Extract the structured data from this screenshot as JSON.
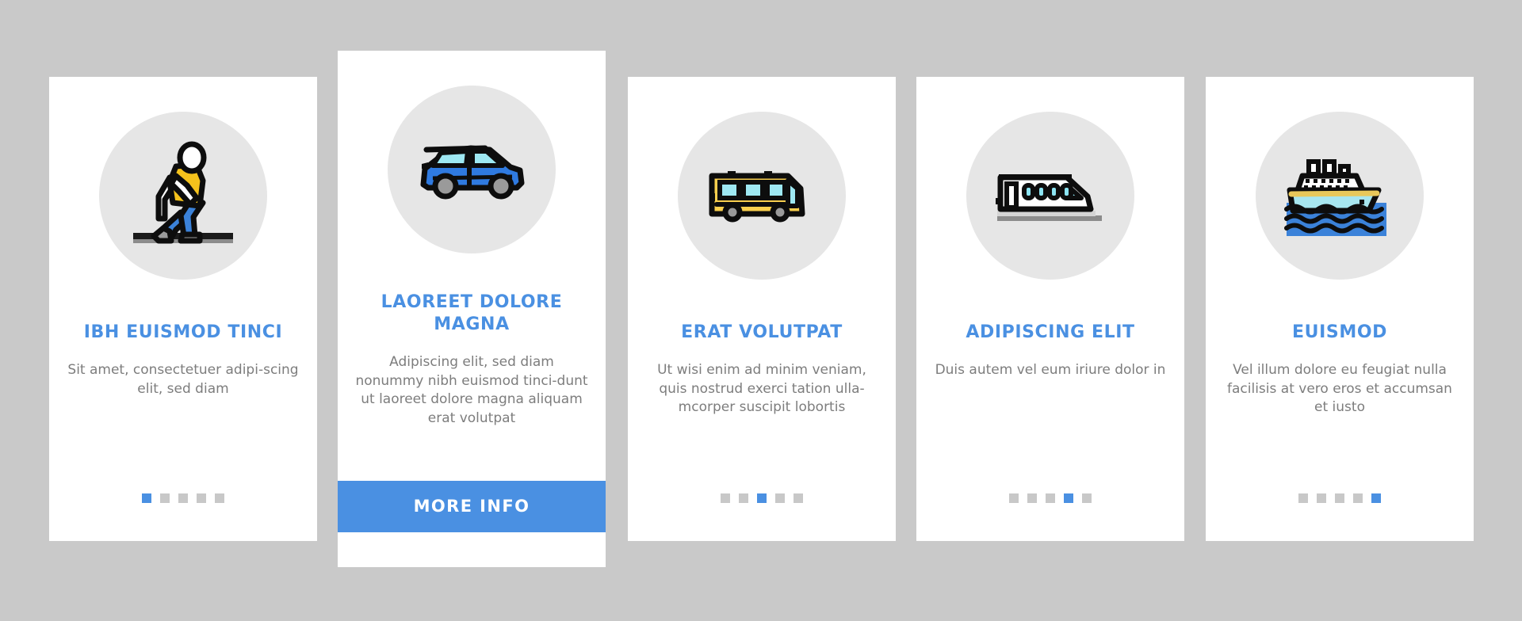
{
  "background_color": "#c9c9c9",
  "accent_color": "#4a90e2",
  "title_color": "#4a90e2",
  "body_color": "#7d7d7d",
  "cards": [
    {
      "icon": "walking-person-icon",
      "title": "IBH EUISMOD TINCI",
      "description": "Sit amet, consectetuer adipi-scing elit, sed diam",
      "dots_total": 5,
      "dots_active_index": 0,
      "featured": false
    },
    {
      "icon": "car-icon",
      "title": "LAOREET DOLORE MAGNA",
      "description": "Adipiscing elit, sed diam nonummy nibh euismod tinci-dunt ut laoreet dolore magna aliquam erat volutpat",
      "cta_label": "MORE INFO",
      "dots_total": 5,
      "dots_active_index": 1,
      "featured": true
    },
    {
      "icon": "bus-icon",
      "title": "ERAT VOLUTPAT",
      "description": "Ut wisi enim ad minim veniam, quis nostrud exerci tation ulla-mcorper suscipit lobortis",
      "dots_total": 5,
      "dots_active_index": 2,
      "featured": false
    },
    {
      "icon": "train-icon",
      "title": "ADIPISCING ELIT",
      "description": "Duis autem vel eum iriure dolor in",
      "dots_total": 5,
      "dots_active_index": 3,
      "featured": false
    },
    {
      "icon": "cruise-ship-icon",
      "title": "EUISMOD",
      "description": "Vel illum dolore eu feugiat nulla facilisis at vero eros et accumsan et iusto",
      "dots_total": 5,
      "dots_active_index": 4,
      "featured": false
    }
  ]
}
